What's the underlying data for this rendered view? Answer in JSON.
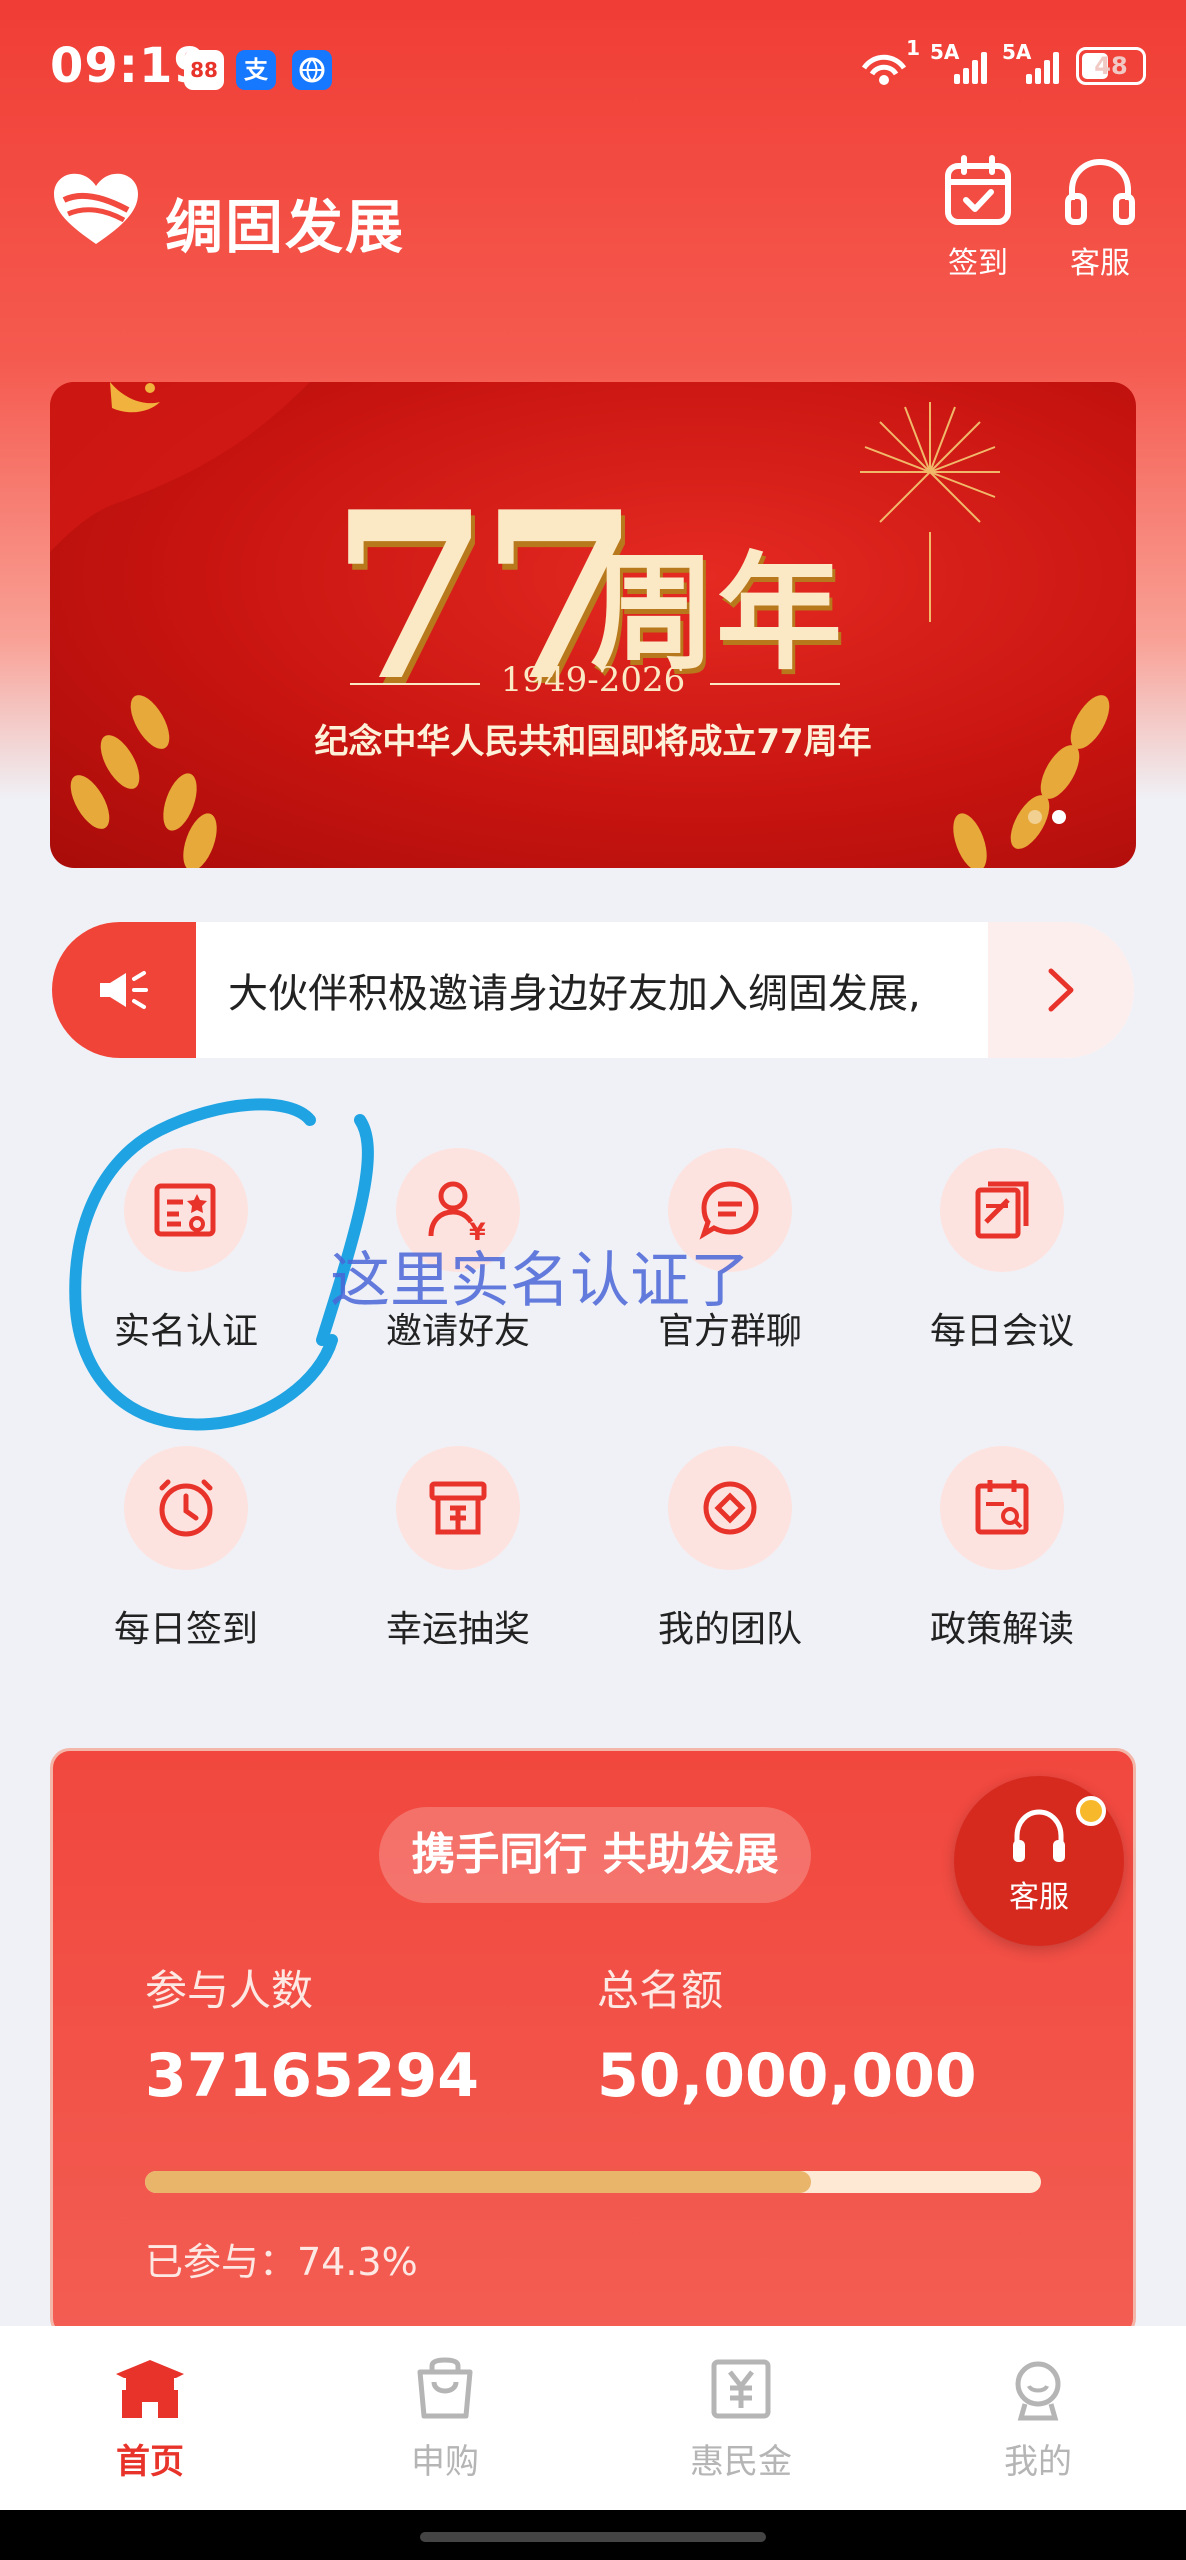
{
  "status_bar": {
    "time": "09:19",
    "app1": "88",
    "app2": "支",
    "signal1_label": "5A",
    "signal2_label": "5A",
    "wifi_label": "1",
    "battery": "48"
  },
  "header": {
    "title": "绸固发展",
    "checkin_label": "签到",
    "service_label": "客服"
  },
  "banner": {
    "number": "77",
    "title": "周年",
    "years": "1949-2026",
    "subtitle": "纪念中华人民共和国即将成立77周年",
    "active_slide": 2,
    "slide_count": 2
  },
  "notice": {
    "text": "大伙伴积极邀请身边好友加入绸固发展,"
  },
  "grid": {
    "items": [
      {
        "label": "实名认证",
        "icon": "id-card-icon"
      },
      {
        "label": "邀请好友",
        "icon": "invite-user-icon"
      },
      {
        "label": "官方群聊",
        "icon": "chat-icon"
      },
      {
        "label": "每日会议",
        "icon": "meeting-icon"
      },
      {
        "label": "每日签到",
        "icon": "clock-icon"
      },
      {
        "label": "幸运抽奖",
        "icon": "lottery-icon"
      },
      {
        "label": "我的团队",
        "icon": "team-icon"
      },
      {
        "label": "政策解读",
        "icon": "policy-icon"
      }
    ]
  },
  "annotation": {
    "text": "这里实名认证了"
  },
  "stats": {
    "slogan": "携手同行 共助发展",
    "participants_label": "参与人数",
    "participants_value": "37165294",
    "quota_label": "总名额",
    "quota_value": "50,000,000",
    "progress_text": "已参与：74.3%",
    "progress": 0.743
  },
  "floating_service": {
    "label": "客服"
  },
  "tabbar": {
    "tabs": [
      {
        "label": "首页",
        "active": true
      },
      {
        "label": "申购",
        "active": false
      },
      {
        "label": "惠民金",
        "active": false
      },
      {
        "label": "我的",
        "active": false
      }
    ]
  },
  "colors": {
    "primary": "#e8332a",
    "accent_gold": "#e9b56a",
    "annotation_blue": "#29a8e8"
  }
}
